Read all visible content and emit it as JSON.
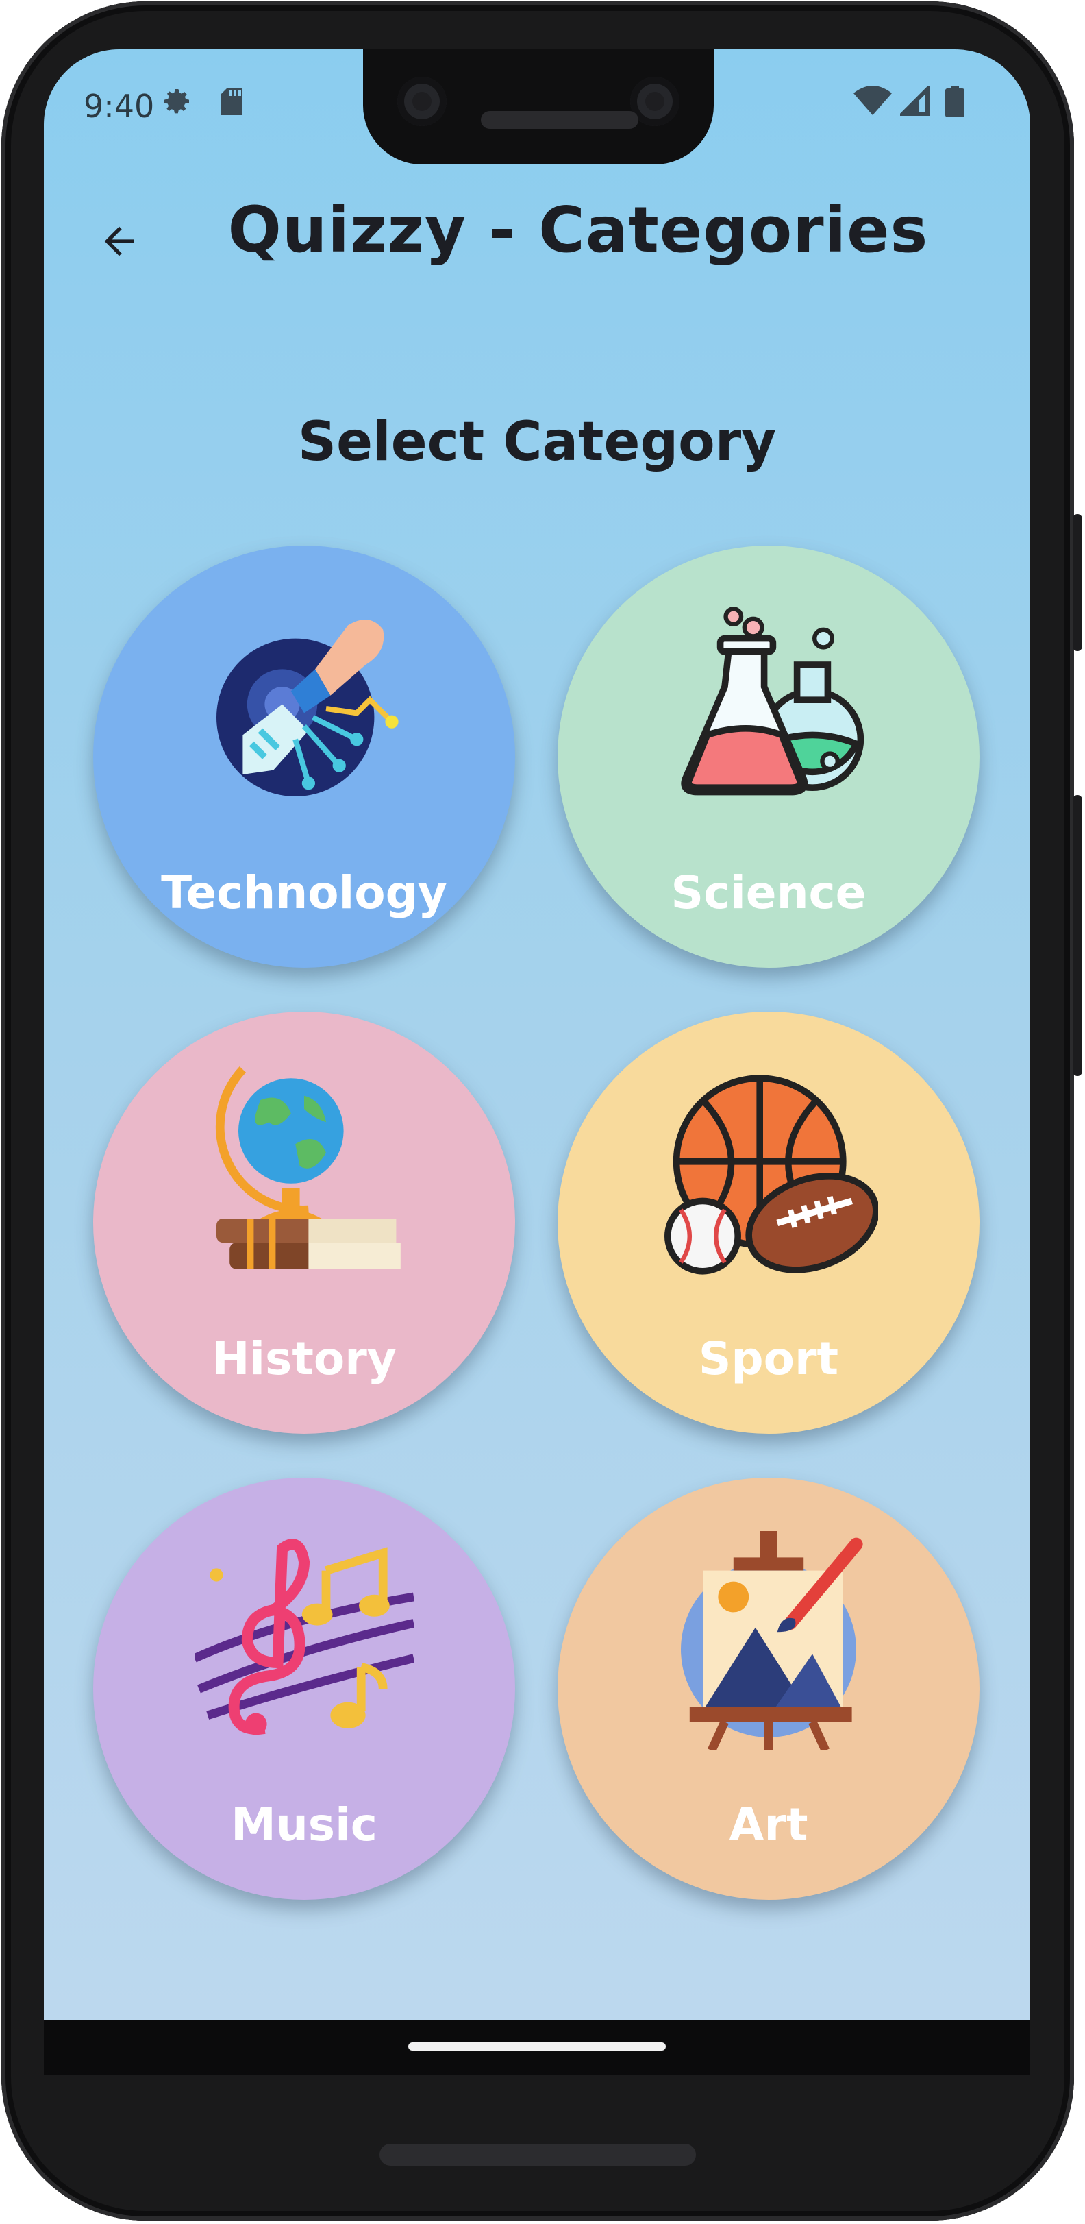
{
  "status_bar": {
    "time": "9:40",
    "left_icons": [
      "settings-gear-icon",
      "sd-card-icon"
    ],
    "right_icons": [
      "wifi-icon",
      "cellular-signal-icon",
      "battery-icon"
    ]
  },
  "app_bar": {
    "back_icon": "arrow-back-icon",
    "title": "Quizzy - Categories"
  },
  "main": {
    "heading": "Select Category",
    "categories": [
      {
        "label": "Technology",
        "icon": "robot-hand-circuit-icon",
        "color": "#7ab1ef"
      },
      {
        "label": "Science",
        "icon": "chemistry-flasks-icon",
        "color": "#b8e2cc"
      },
      {
        "label": "History",
        "icon": "globe-books-icon",
        "color": "#eab8c9"
      },
      {
        "label": "Sport",
        "icon": "sport-balls-icon",
        "color": "#f8da9c"
      },
      {
        "label": "Music",
        "icon": "music-notes-icon",
        "color": "#c6b0e6"
      },
      {
        "label": "Art",
        "icon": "easel-painting-icon",
        "color": "#f1c8a0"
      }
    ]
  },
  "colors": {
    "background_top": "#8bcdef",
    "background_bottom": "#bcd8ee",
    "text_dark": "#1c1e24",
    "label_text": "#ffffff"
  }
}
